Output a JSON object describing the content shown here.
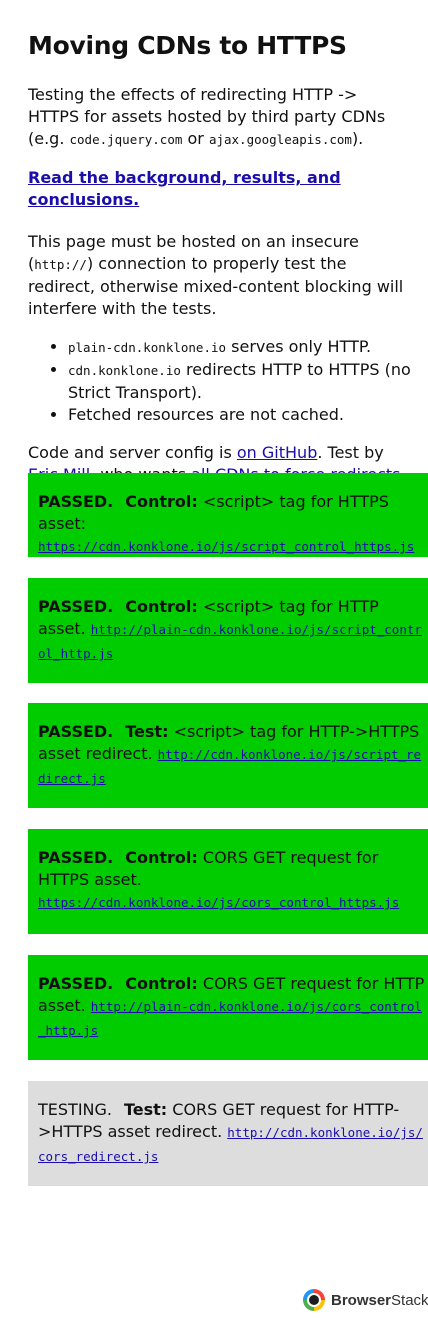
{
  "page": {
    "title": "Moving CDNs to HTTPS",
    "intro": {
      "text_before": "Testing the effects of redirecting HTTP -> HTTPS for assets hosted by third party CDNs (e.g. ",
      "code1": "code.jquery.com",
      "or": " or ",
      "code2": "ajax.googleapis.com",
      "text_after": ")."
    },
    "read_link": "Read the background, results, and conclusions.",
    "hosting": {
      "before": "This page must be hosted on an insecure (",
      "code": "http://",
      "after": ") connection to properly test the redirect, otherwise mixed-content blocking will interfere with the tests."
    },
    "bullets": [
      {
        "code": "plain-cdn.konklone.io",
        "text": " serves only HTTP."
      },
      {
        "code": "cdn.konklone.io",
        "text": " redirects HTTP to HTTPS (no Strict Transport)."
      },
      {
        "code": "",
        "text": "Fetched resources are not cached."
      }
    ],
    "credits": {
      "t1": "Code and server config is ",
      "github_link": "on GitHub",
      "t2": ". Test by ",
      "author_link": "Eric Mill",
      "t3": ", who wants ",
      "cdn_link": "all CDNs to force redirects from HTTP to HTTPS",
      "t4": "."
    }
  },
  "tests": [
    {
      "status": "PASSED.",
      "kind": "Control:",
      "description": " <script> tag for HTTPS asset: ",
      "url": "https://cdn.konklone.io/js/script_control_https.js",
      "state_color": "#00cc00"
    },
    {
      "status": "PASSED.",
      "kind": "Control:",
      "description": " <script> tag for HTTP asset. ",
      "url": "http://plain-cdn.konklone.io/js/script_control_http.js",
      "state_color": "#00cc00"
    },
    {
      "status": "PASSED.",
      "kind": "Test:",
      "description": " <script> tag for HTTP->HTTPS asset redirect. ",
      "url": "http://cdn.konklone.io/js/script_redirect.js",
      "state_color": "#00cc00"
    },
    {
      "status": "PASSED.",
      "kind": "Control:",
      "description": " CORS GET request for HTTPS asset. ",
      "url": "https://cdn.konklone.io/js/cors_control_https.js",
      "state_color": "#00cc00"
    },
    {
      "status": "PASSED.",
      "kind": "Control:",
      "description": " CORS GET request for HTTP asset. ",
      "url": "http://plain-cdn.konklone.io/js/cors_control_http.js",
      "state_color": "#00cc00"
    },
    {
      "status": "TESTING.",
      "kind": "Test:",
      "description": " CORS GET request for HTTP->HTTPS asset redirect. ",
      "url": "http://cdn.konklone.io/js/cors_redirect.js",
      "state_color": "#dddddd"
    }
  ],
  "brand": {
    "name_bold": "Browser",
    "name_rest": "Stack",
    "icon": "browserstack-logo-icon"
  }
}
